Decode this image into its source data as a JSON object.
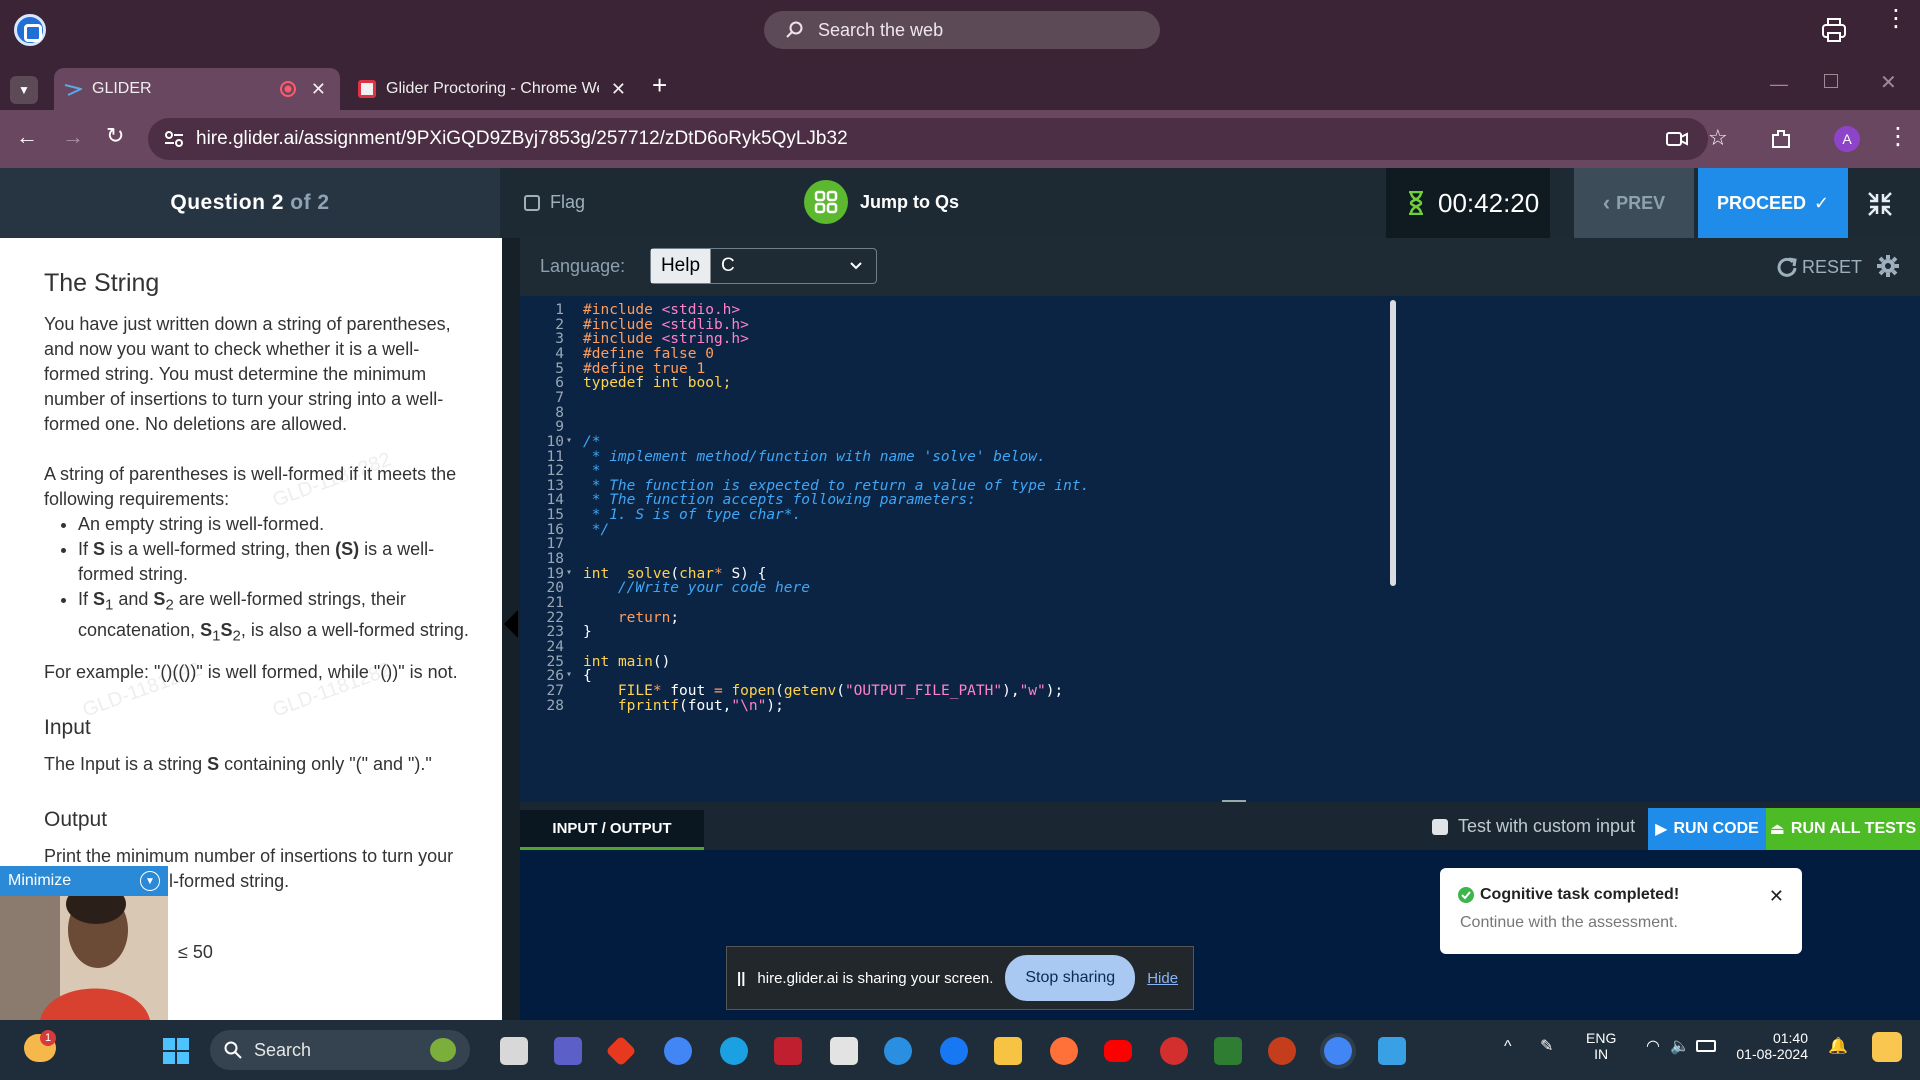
{
  "browser": {
    "web_search_placeholder": "Search the web",
    "tabs": [
      {
        "title": "GLIDER",
        "active": true
      },
      {
        "title": "Glider Proctoring - Chrome Wel",
        "active": false
      }
    ],
    "url": "hire.glider.ai/assignment/9PXiGQD9ZByj7853g/257712/zDtD6oRyk5QyLJb32",
    "profile_initial": "A"
  },
  "header": {
    "question_label": "Question 2",
    "question_total": "of 2",
    "flag_label": "Flag",
    "jump_label": "Jump to Qs",
    "timer": "00:42:20",
    "prev_label": "PREV",
    "proceed_label": "PROCEED"
  },
  "problem": {
    "title": "The String",
    "para1": "You have just written down a string of parentheses, and now you want to check whether it is a well-formed string. You must determine the minimum number of insertions to turn your string into a well-formed one. No deletions are allowed.",
    "para2": "A string of parentheses is well-formed if it meets the following requirements:",
    "bullet1": "An empty string is well-formed.",
    "bullet2_pre": "If ",
    "bullet2_s": "S",
    "bullet2_mid": " is a well-formed string, then ",
    "bullet2_ps": "(S)",
    "bullet2_post": " is a well-formed string.",
    "bullet3_pre": "If ",
    "bullet3_s1": "S",
    "bullet3_and": " and ",
    "bullet3_s2": "S",
    "bullet3_mid": " are well-formed strings, their concatenation, ",
    "bullet3_s1s2a": "S",
    "bullet3_s1s2b": "S",
    "bullet3_post": ", is also a well-formed string.",
    "sub1": "1",
    "sub2": "2",
    "example": "For example: \"()(())\" is well formed, while \"())\" is not.",
    "input_heading": "Input",
    "input_text_pre": "The Input is a string ",
    "input_text_s": "S",
    "input_text_post": " containing only \"(\" and \").\"",
    "output_heading": "Output",
    "output_text": "Print the minimum number of insertions to turn your string into a well-formed string.",
    "constraint_fragment": "≤ 50",
    "watermark": "GLD-1181282"
  },
  "editor": {
    "language_label": "Language:",
    "help_label": "Help",
    "language_value": "C",
    "reset_label": "RESET",
    "lines": [
      {
        "n": "1",
        "parts": [
          {
            "c": "pp",
            "t": "#include "
          },
          {
            "c": "str",
            "t": "<stdio.h>"
          }
        ]
      },
      {
        "n": "2",
        "parts": [
          {
            "c": "pp",
            "t": "#include "
          },
          {
            "c": "str",
            "t": "<stdlib.h>"
          }
        ]
      },
      {
        "n": "3",
        "parts": [
          {
            "c": "pp",
            "t": "#include "
          },
          {
            "c": "str",
            "t": "<string.h>"
          }
        ]
      },
      {
        "n": "4",
        "parts": [
          {
            "c": "pp",
            "t": "#define false 0"
          }
        ]
      },
      {
        "n": "5",
        "parts": [
          {
            "c": "pp",
            "t": "#define true 1"
          }
        ]
      },
      {
        "n": "6",
        "parts": [
          {
            "c": "kw",
            "t": "typedef int bool;"
          }
        ]
      },
      {
        "n": "7",
        "parts": []
      },
      {
        "n": "8",
        "parts": []
      },
      {
        "n": "9",
        "parts": []
      },
      {
        "n": "10",
        "fold": true,
        "parts": [
          {
            "c": "cm",
            "t": "/*"
          }
        ]
      },
      {
        "n": "11",
        "parts": [
          {
            "c": "cm",
            "t": " * implement method/function with name 'solve' below."
          }
        ]
      },
      {
        "n": "12",
        "parts": [
          {
            "c": "cm",
            "t": " *"
          }
        ]
      },
      {
        "n": "13",
        "parts": [
          {
            "c": "cm",
            "t": " * The function is expected to return a value of type int."
          }
        ]
      },
      {
        "n": "14",
        "parts": [
          {
            "c": "cm",
            "t": " * The function accepts following parameters:"
          }
        ]
      },
      {
        "n": "15",
        "parts": [
          {
            "c": "cm",
            "t": " * 1. S is of type char*."
          }
        ]
      },
      {
        "n": "16",
        "parts": [
          {
            "c": "cm",
            "t": " */"
          }
        ]
      },
      {
        "n": "17",
        "parts": []
      },
      {
        "n": "18",
        "parts": []
      },
      {
        "n": "19",
        "fold": true,
        "parts": [
          {
            "c": "kw",
            "t": "int"
          },
          {
            "c": "tx",
            "t": "  "
          },
          {
            "c": "fn",
            "t": "solve"
          },
          {
            "c": "tx",
            "t": "("
          },
          {
            "c": "kw",
            "t": "char"
          },
          {
            "c": "ty",
            "t": "*"
          },
          {
            "c": "tx",
            "t": " S) {"
          }
        ]
      },
      {
        "n": "20",
        "parts": [
          {
            "c": "cm",
            "t": "    //Write your code here"
          }
        ]
      },
      {
        "n": "21",
        "parts": []
      },
      {
        "n": "22",
        "parts": [
          {
            "c": "ty",
            "t": "    return"
          },
          {
            "c": "tx",
            "t": ";"
          }
        ]
      },
      {
        "n": "23",
        "parts": [
          {
            "c": "tx",
            "t": "}"
          }
        ]
      },
      {
        "n": "24",
        "parts": []
      },
      {
        "n": "25",
        "parts": [
          {
            "c": "kw",
            "t": "int"
          },
          {
            "c": "tx",
            "t": " "
          },
          {
            "c": "fn",
            "t": "main"
          },
          {
            "c": "tx",
            "t": "()"
          }
        ]
      },
      {
        "n": "26",
        "fold": true,
        "parts": [
          {
            "c": "tx",
            "t": "{"
          }
        ]
      },
      {
        "n": "27",
        "parts": [
          {
            "c": "kw",
            "t": "    FILE"
          },
          {
            "c": "ty",
            "t": "*"
          },
          {
            "c": "tx",
            "t": " fout "
          },
          {
            "c": "ty",
            "t": "="
          },
          {
            "c": "tx",
            "t": " "
          },
          {
            "c": "fn",
            "t": "fopen"
          },
          {
            "c": "tx",
            "t": "("
          },
          {
            "c": "fn",
            "t": "getenv"
          },
          {
            "c": "tx",
            "t": "("
          },
          {
            "c": "str",
            "t": "\"OUTPUT_FILE_PATH\""
          },
          {
            "c": "tx",
            "t": "),"
          },
          {
            "c": "str",
            "t": "\"w\""
          },
          {
            "c": "tx",
            "t": ");"
          }
        ]
      },
      {
        "n": "28",
        "parts": [
          {
            "c": "fn",
            "t": "    fprintf"
          },
          {
            "c": "tx",
            "t": "(fout,"
          },
          {
            "c": "str",
            "t": "\"\\n\""
          },
          {
            "c": "tx",
            "t": ");"
          }
        ]
      }
    ]
  },
  "io": {
    "tab_label": "INPUT / OUTPUT",
    "custom_input_label": "Test with custom input",
    "run_code_label": "RUN CODE",
    "run_all_label": "RUN ALL TESTS"
  },
  "toast": {
    "title": "Cognitive task completed!",
    "subtitle": "Continue with the assessment."
  },
  "sharing": {
    "message": "hire.glider.ai is sharing your screen.",
    "stop_label": "Stop sharing",
    "hide_label": "Hide"
  },
  "webcam": {
    "minimize_label": "Minimize"
  },
  "taskbar": {
    "search_label": "Search",
    "weather_badge": "1",
    "lang_top": "ENG",
    "lang_bottom": "IN",
    "time": "01:40",
    "date": "01-08-2024"
  }
}
